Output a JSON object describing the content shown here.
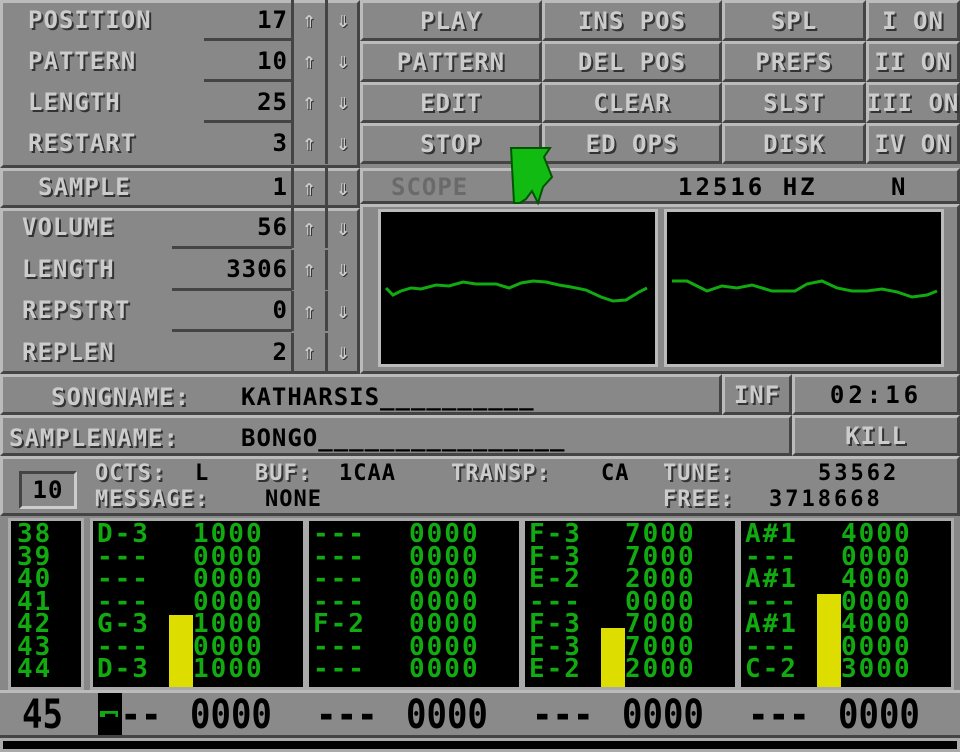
{
  "song_controls": [
    {
      "label": "POSITION",
      "value": "17"
    },
    {
      "label": "PATTERN",
      "value": "10"
    },
    {
      "label": "LENGTH",
      "value": "25"
    },
    {
      "label": "RESTART",
      "value": "3"
    }
  ],
  "sample_controls": [
    {
      "label": "SAMPLE",
      "value": "1"
    },
    {
      "label": "VOLUME",
      "value": "56"
    },
    {
      "label": "LENGTH",
      "value": "3306"
    },
    {
      "label": "REPSTRT",
      "value": "0"
    },
    {
      "label": "REPLEN",
      "value": "2"
    }
  ],
  "arrows": {
    "up": "⇑",
    "down": "⇓",
    "up_icon": "arrow-up-icon",
    "down_icon": "arrow-down-icon"
  },
  "buttons": {
    "col1": [
      "PLAY",
      "PATTERN",
      "EDIT",
      "STOP"
    ],
    "col2": [
      "INS POS",
      "DEL POS",
      "CLEAR",
      "ED OPS"
    ],
    "col3": [
      "SPL",
      "PREFS",
      "SLST",
      "DISK"
    ],
    "channels": [
      "I ON",
      "II ON",
      "III ON",
      "IV ON"
    ]
  },
  "scope": {
    "label": "SCOPE",
    "freq": "12516 HZ",
    "mode": "N"
  },
  "songname": {
    "label": "SONGNAME:",
    "value": "KATHARSIS__________",
    "inf": "INF",
    "time": "02:16"
  },
  "samplename": {
    "label": "SAMPLENAME:",
    "value": "BONGO________________",
    "kill": "KILL"
  },
  "status": {
    "pattern_num": "10",
    "octs_label": "OCTS:",
    "octs_value": "L",
    "buf_label": "BUF:",
    "buf_value": "1CAA",
    "transp_label": "TRANSP:",
    "transp_value": "CA",
    "tune_label": "TUNE:",
    "tune_value": "53562",
    "message_label": "MESSAGE:",
    "message_value": "NONE",
    "free_label": "FREE:",
    "free_value": "3718668"
  },
  "pattern": {
    "row_numbers": [
      "38",
      "39",
      "40",
      "41",
      "42",
      "43",
      "44"
    ],
    "tracks": [
      {
        "notes": [
          "D-3",
          "---",
          "---",
          "---",
          "G-3",
          "---",
          "D-3"
        ],
        "effects": [
          "1000",
          "0000",
          "0000",
          "0000",
          "1000",
          "0000",
          "1000"
        ],
        "vu_level": 0.45
      },
      {
        "notes": [
          "---",
          "---",
          "---",
          "---",
          "F-2",
          "---",
          "---"
        ],
        "effects": [
          "0000",
          "0000",
          "0000",
          "0000",
          "0000",
          "0000",
          "0000"
        ],
        "vu_level": 0
      },
      {
        "notes": [
          "F-3",
          "F-3",
          "E-2",
          "---",
          "F-3",
          "F-3",
          "E-2"
        ],
        "effects": [
          "7000",
          "7000",
          "2000",
          "0000",
          "7000",
          "7000",
          "2000"
        ],
        "vu_level": 0.37
      },
      {
        "notes": [
          "A#1",
          "---",
          "A#1",
          "---",
          "A#1",
          "---",
          "C-2"
        ],
        "effects": [
          "4000",
          "0000",
          "4000",
          "0000",
          "4000",
          "0000",
          "3000"
        ],
        "vu_level": 0.58
      }
    ],
    "current_row": {
      "number": "45",
      "tracks": [
        {
          "note": "---",
          "effect": "0000"
        },
        {
          "note": "---",
          "effect": "0000"
        },
        {
          "note": "---",
          "effect": "0000"
        },
        {
          "note": "---",
          "effect": "0000"
        }
      ]
    }
  }
}
